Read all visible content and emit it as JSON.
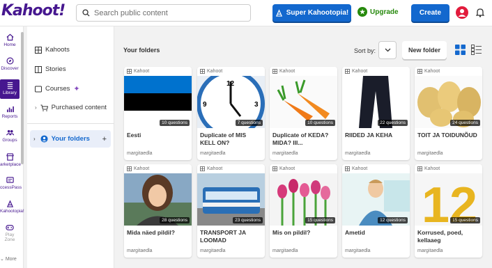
{
  "header": {
    "logo": "Kahoot!",
    "search_placeholder": "Search public content",
    "super_label": "Super Kahootopia!",
    "upgrade_label": "Upgrade",
    "create_label": "Create"
  },
  "rail": [
    {
      "label": "Home",
      "icon": "home-icon"
    },
    {
      "label": "Discover",
      "icon": "compass-icon"
    },
    {
      "label": "Library",
      "icon": "library-icon",
      "active": true
    },
    {
      "label": "Reports",
      "icon": "chart-icon"
    },
    {
      "label": "Groups",
      "icon": "groups-icon"
    },
    {
      "label": "arketplace",
      "icon": "store-icon"
    },
    {
      "label": "ccessPass",
      "icon": "pass-icon"
    },
    {
      "label": "Kahootopia!",
      "icon": "kahootopia-icon"
    },
    {
      "label": "Play Zone",
      "icon": "gamepad-icon"
    }
  ],
  "rail_more": "More",
  "sidebar": {
    "kahoots": "Kahoots",
    "stories": "Stories",
    "courses": "Courses",
    "purchased": "Purchased content",
    "your_folders": "Your folders"
  },
  "main": {
    "title": "Your folders",
    "sort_label": "Sort by:",
    "new_folder": "New folder"
  },
  "card_type": "Kahoot",
  "cards": [
    {
      "title": "Eesti",
      "questions": "10 questions",
      "author": "margitaedla",
      "image": "flag"
    },
    {
      "title": "Duplicate of MIS KELL ON?",
      "questions": "7 questions",
      "author": "margitaedla",
      "image": "clock"
    },
    {
      "title": "Duplicate of KEDA? MIDA? III...",
      "questions": "10 questions",
      "author": "margitaedla",
      "image": "carrots"
    },
    {
      "title": "RIIDED JA KEHA",
      "questions": "22 questions",
      "author": "margitaedla",
      "image": "pants"
    },
    {
      "title": "TOIT JA TOIDUNÕUD",
      "questions": "24 questions",
      "author": "margitaedla",
      "image": "potatoes"
    },
    {
      "title": "Mida näed pildil?",
      "questions": "28 questions",
      "author": "margitaedla",
      "image": "woman"
    },
    {
      "title": "TRANSPORT JA LOOMAD",
      "questions": "23 questions",
      "author": "margitaedla",
      "image": "tram"
    },
    {
      "title": "Mis on pildil?",
      "questions": "15 questions",
      "author": "margitaedla",
      "image": "tulips"
    },
    {
      "title": "Ametid",
      "questions": "12 questions",
      "author": "margitaedla",
      "image": "teacher"
    },
    {
      "title": "Korrused, poed, kellaaeg",
      "questions": "15 questions",
      "author": "margitaedla",
      "image": "twelve"
    }
  ]
}
